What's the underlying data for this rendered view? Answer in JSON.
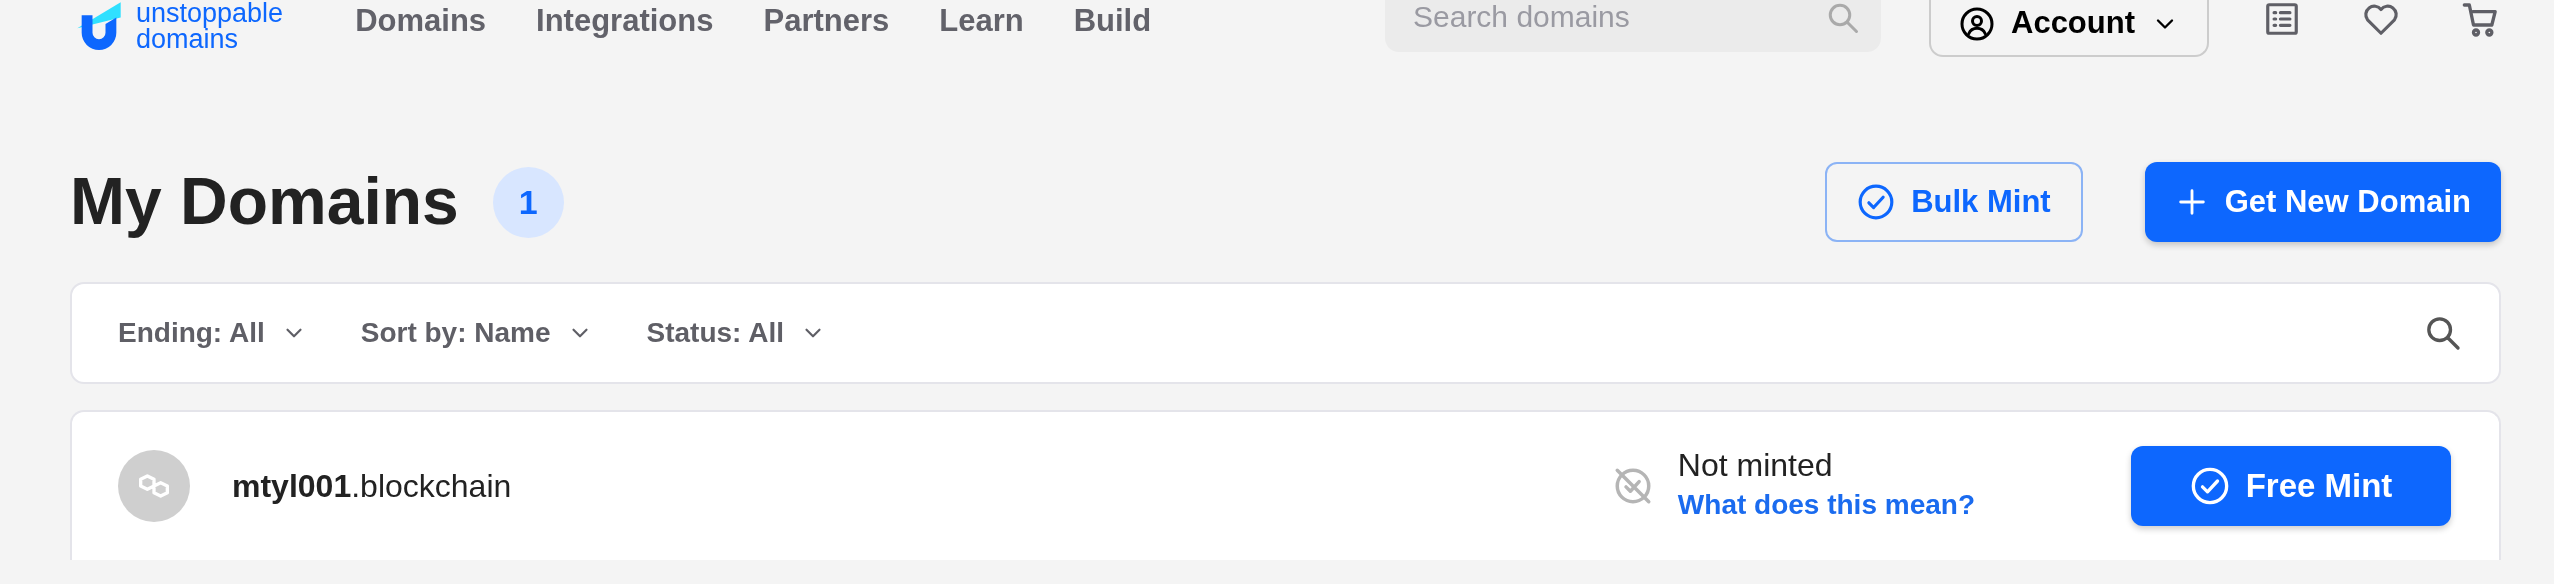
{
  "header": {
    "logo": {
      "line_1": "unstoppable",
      "line_2": "domains"
    },
    "nav": [
      "Domains",
      "Integrations",
      "Partners",
      "Learn",
      "Build"
    ],
    "search": {
      "placeholder": "Search domains"
    },
    "account_button": "Account"
  },
  "page": {
    "title": "My Domains",
    "count": "1",
    "buttons": [
      {
        "kind": "outline",
        "label": "Bulk Mint"
      },
      {
        "kind": "primary",
        "label": "Get New Domain"
      }
    ]
  },
  "filters": [
    "Ending: All",
    "Sort by: Name",
    "Status: All"
  ],
  "domains": [
    {
      "name": "mtyl001",
      "extension": ".blockchain",
      "status": "Not minted",
      "help_link": "What does this mean?",
      "action": "Free Mint"
    }
  ]
}
